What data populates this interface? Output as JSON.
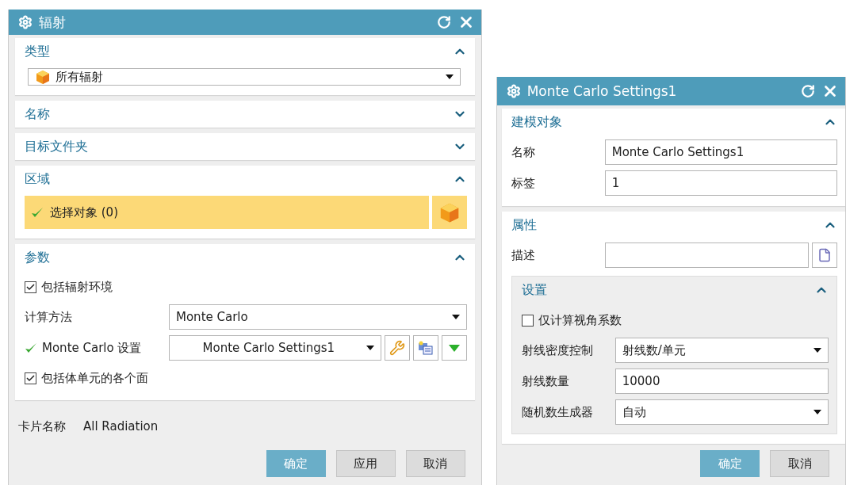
{
  "radiation_dialog": {
    "title": "辐射",
    "sections": [
      {
        "kind": "dropdown",
        "title": "类型",
        "expanded": true,
        "value": "所有辐射"
      },
      {
        "kind": "empty",
        "title": "名称",
        "expanded": false
      },
      {
        "kind": "empty",
        "title": "目标文件夹",
        "expanded": false
      },
      {
        "kind": "selection",
        "title": "区域",
        "expanded": true,
        "label": "选择对象 (0)",
        "done": true
      },
      {
        "kind": "params",
        "title": "参数",
        "expanded": true,
        "rows": [
          {
            "kind": "checkbox",
            "label": "包括辐射环境",
            "checked": true
          },
          {
            "kind": "select",
            "label": "计算方法",
            "value": "Monte Carlo"
          },
          {
            "kind": "object_select",
            "label": "Monte Carlo 设置",
            "value": "Monte Carlo Settings1",
            "done": true
          },
          {
            "kind": "checkbox",
            "label": "包括体单元的各个面",
            "checked": true
          }
        ]
      }
    ],
    "card_name": {
      "label": "卡片名称",
      "value": "All Radiation"
    },
    "buttons": [
      {
        "label": "确定",
        "primary": true
      },
      {
        "label": "应用",
        "primary": false
      },
      {
        "label": "取消",
        "primary": false
      }
    ]
  },
  "settings_dialog": {
    "title": "Monte Carlo Settings1",
    "sections": [
      {
        "title": "建模对象",
        "expanded": true,
        "rows": [
          {
            "kind": "text",
            "label": "名称",
            "value": "Monte Carlo Settings1"
          },
          {
            "kind": "text",
            "label": "标签",
            "value": "1"
          }
        ]
      },
      {
        "title": "属性",
        "expanded": true,
        "rows": [
          {
            "kind": "text_browse",
            "label": "描述"
          }
        ],
        "group": {
          "title": "设置",
          "expanded": true,
          "rows": [
            {
              "kind": "checkbox",
              "label": "仅计算视角系数",
              "checked": false
            },
            {
              "kind": "select",
              "label": "射线密度控制",
              "value": "射线数/单元"
            },
            {
              "kind": "text",
              "label": "射线数量",
              "value": "10000"
            },
            {
              "kind": "select",
              "label": "随机数生成器",
              "value": "自动"
            }
          ]
        }
      }
    ],
    "buttons": [
      {
        "label": "确定",
        "primary": true
      },
      {
        "label": "取消",
        "primary": false
      }
    ]
  }
}
